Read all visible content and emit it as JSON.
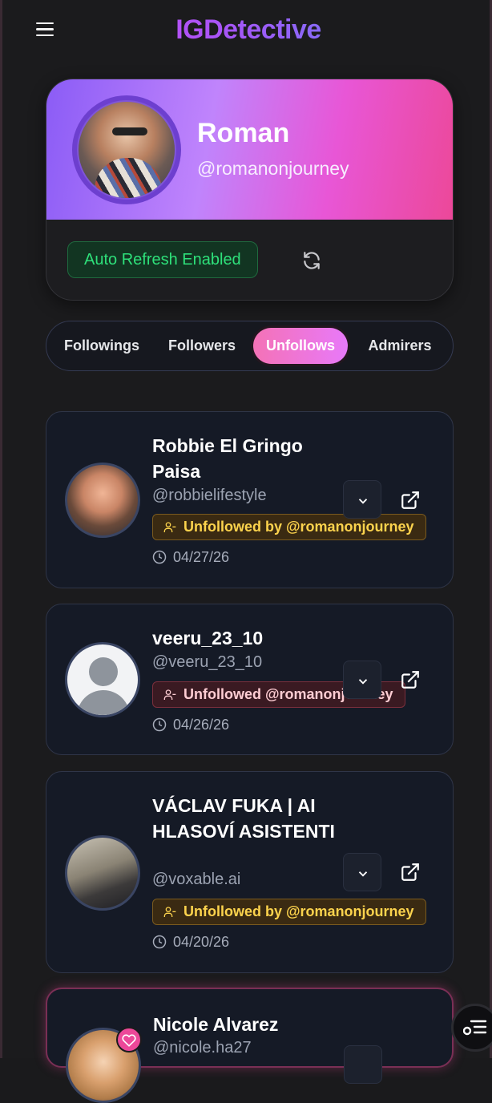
{
  "app": {
    "brand": "IGDetective"
  },
  "profile": {
    "name": "Roman",
    "handle": "@romanonjourney",
    "auto_refresh_label": "Auto Refresh Enabled"
  },
  "tabs": [
    {
      "label": "Followings",
      "active": false
    },
    {
      "label": "Followers",
      "active": false
    },
    {
      "label": "Unfollows",
      "active": true
    },
    {
      "label": "Admirers",
      "active": false
    }
  ],
  "users": [
    {
      "name": "Robbie El Gringo Paisa",
      "handle": "@robbielifestyle",
      "badge": "Unfollowed by @romanonjourney",
      "date": "04/27/26"
    },
    {
      "name": "veeru_23_10",
      "handle": "@veeru_23_10",
      "badge": "Unfollowed @romanonjourney",
      "date": "04/26/26"
    },
    {
      "name": "VÁCLAV FUKA | AI HLASOVÍ ASISTENTI",
      "handle": "@voxable.ai",
      "badge": "Unfollowed by @romanonjourney",
      "date": "04/20/26"
    },
    {
      "name": "Nicole Alvarez",
      "handle": "@nicole.ha27"
    }
  ],
  "colors": {
    "accent_pink": "#ec4899",
    "accent_purple": "#a855f7",
    "success_green": "#2ee07a",
    "badge_yellow": "#fcd34d"
  }
}
